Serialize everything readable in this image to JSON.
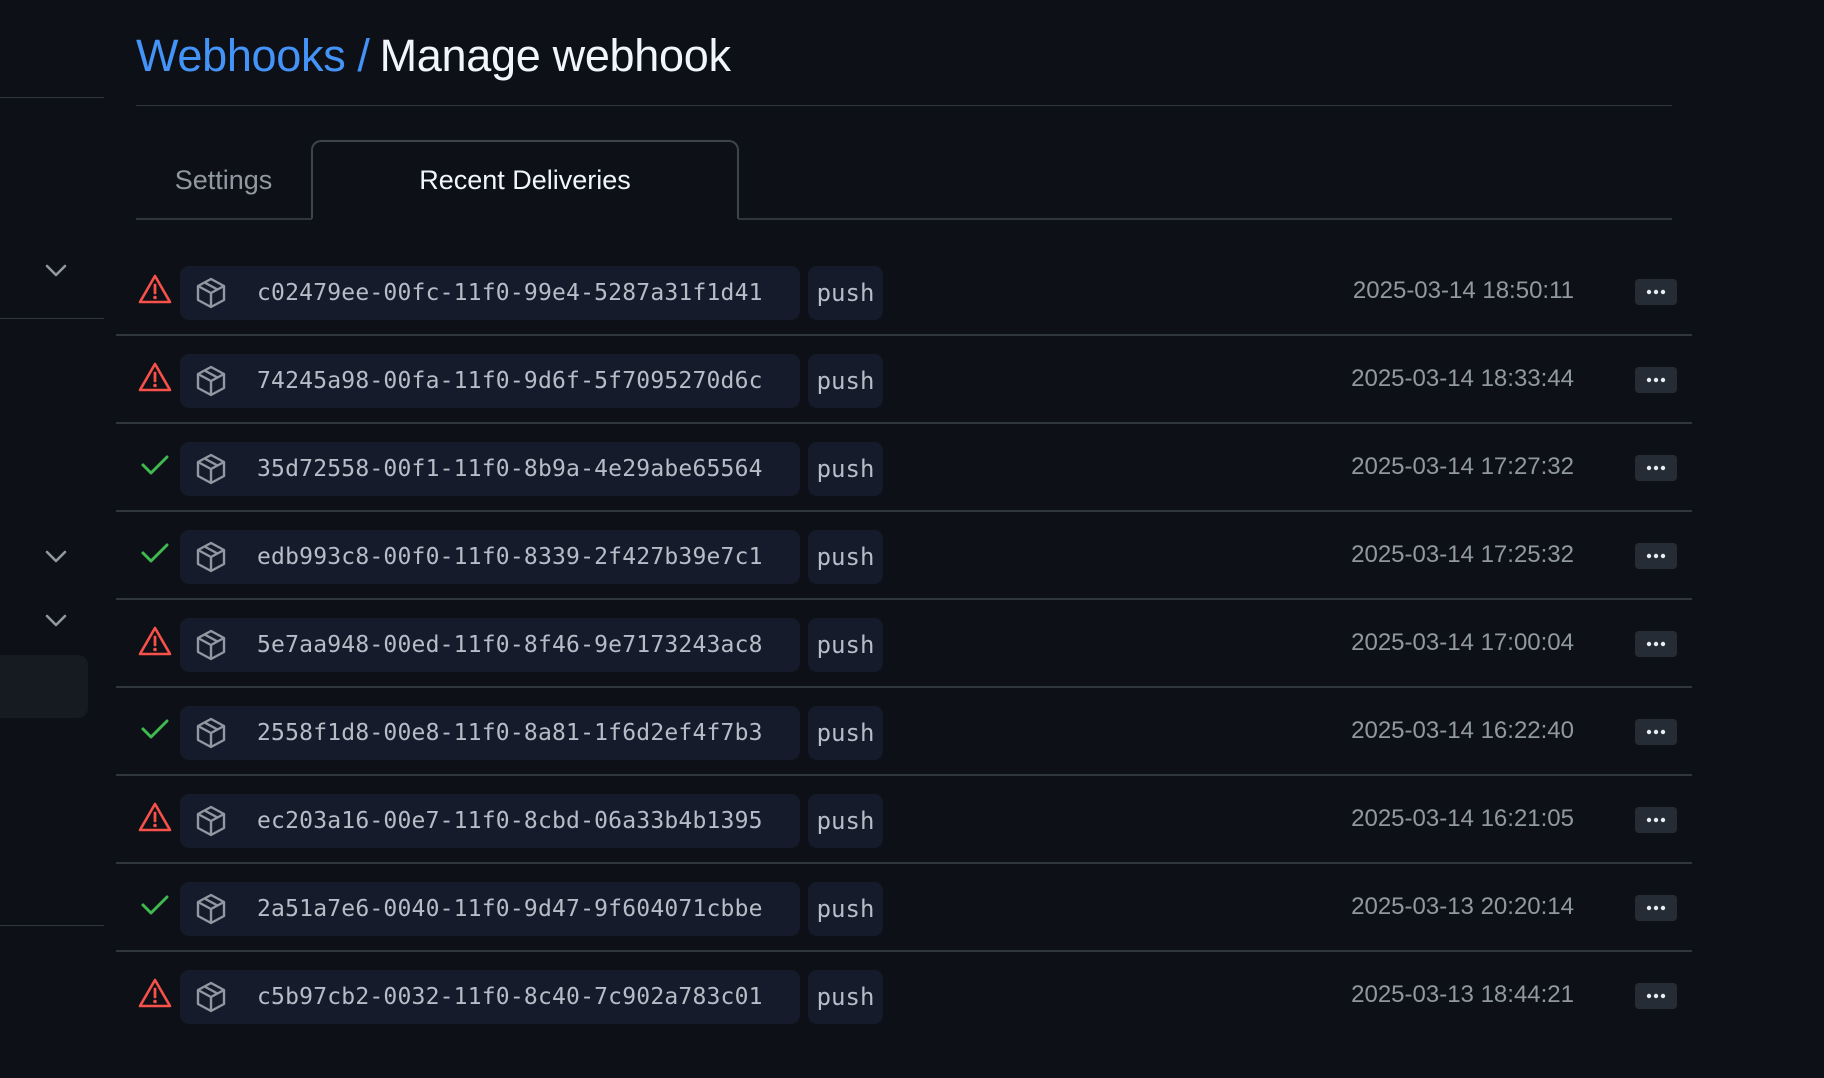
{
  "header": {
    "breadcrumb_link": "Webhooks",
    "separator": "/",
    "title": "Manage webhook"
  },
  "tabs": [
    {
      "label": "Settings",
      "active": false
    },
    {
      "label": "Recent Deliveries",
      "active": true
    }
  ],
  "deliveries": [
    {
      "status": "error",
      "guid": "c02479ee-00fc-11f0-99e4-5287a31f1d41",
      "event": "push",
      "timestamp": "2025-03-14 18:50:11"
    },
    {
      "status": "error",
      "guid": "74245a98-00fa-11f0-9d6f-5f7095270d6c",
      "event": "push",
      "timestamp": "2025-03-14 18:33:44"
    },
    {
      "status": "success",
      "guid": "35d72558-00f1-11f0-8b9a-4e29abe65564",
      "event": "push",
      "timestamp": "2025-03-14 17:27:32"
    },
    {
      "status": "success",
      "guid": "edb993c8-00f0-11f0-8339-2f427b39e7c1",
      "event": "push",
      "timestamp": "2025-03-14 17:25:32"
    },
    {
      "status": "error",
      "guid": "5e7aa948-00ed-11f0-8f46-9e7173243ac8",
      "event": "push",
      "timestamp": "2025-03-14 17:00:04"
    },
    {
      "status": "success",
      "guid": "2558f1d8-00e8-11f0-8a81-1f6d2ef4f7b3",
      "event": "push",
      "timestamp": "2025-03-14 16:22:40"
    },
    {
      "status": "error",
      "guid": "ec203a16-00e7-11f0-8cbd-06a33b4b1395",
      "event": "push",
      "timestamp": "2025-03-14 16:21:05"
    },
    {
      "status": "success",
      "guid": "2a51a7e6-0040-11f0-9d47-9f604071cbbe",
      "event": "push",
      "timestamp": "2025-03-13 20:20:14"
    },
    {
      "status": "error",
      "guid": "c5b97cb2-0032-11f0-8c40-7c902a783c01",
      "event": "push",
      "timestamp": "2025-03-13 18:44:21"
    }
  ],
  "icons": {
    "error": "alert-triangle-icon",
    "success": "check-icon",
    "package": "package-icon",
    "more": "kebab-horizontal-icon",
    "chevron": "chevron-down-icon"
  },
  "colors": {
    "background": "#0d1117",
    "link": "#4493f8",
    "error": "#f85149",
    "success": "#3fb950",
    "pill": "#151b2b",
    "border": "#30363d"
  }
}
